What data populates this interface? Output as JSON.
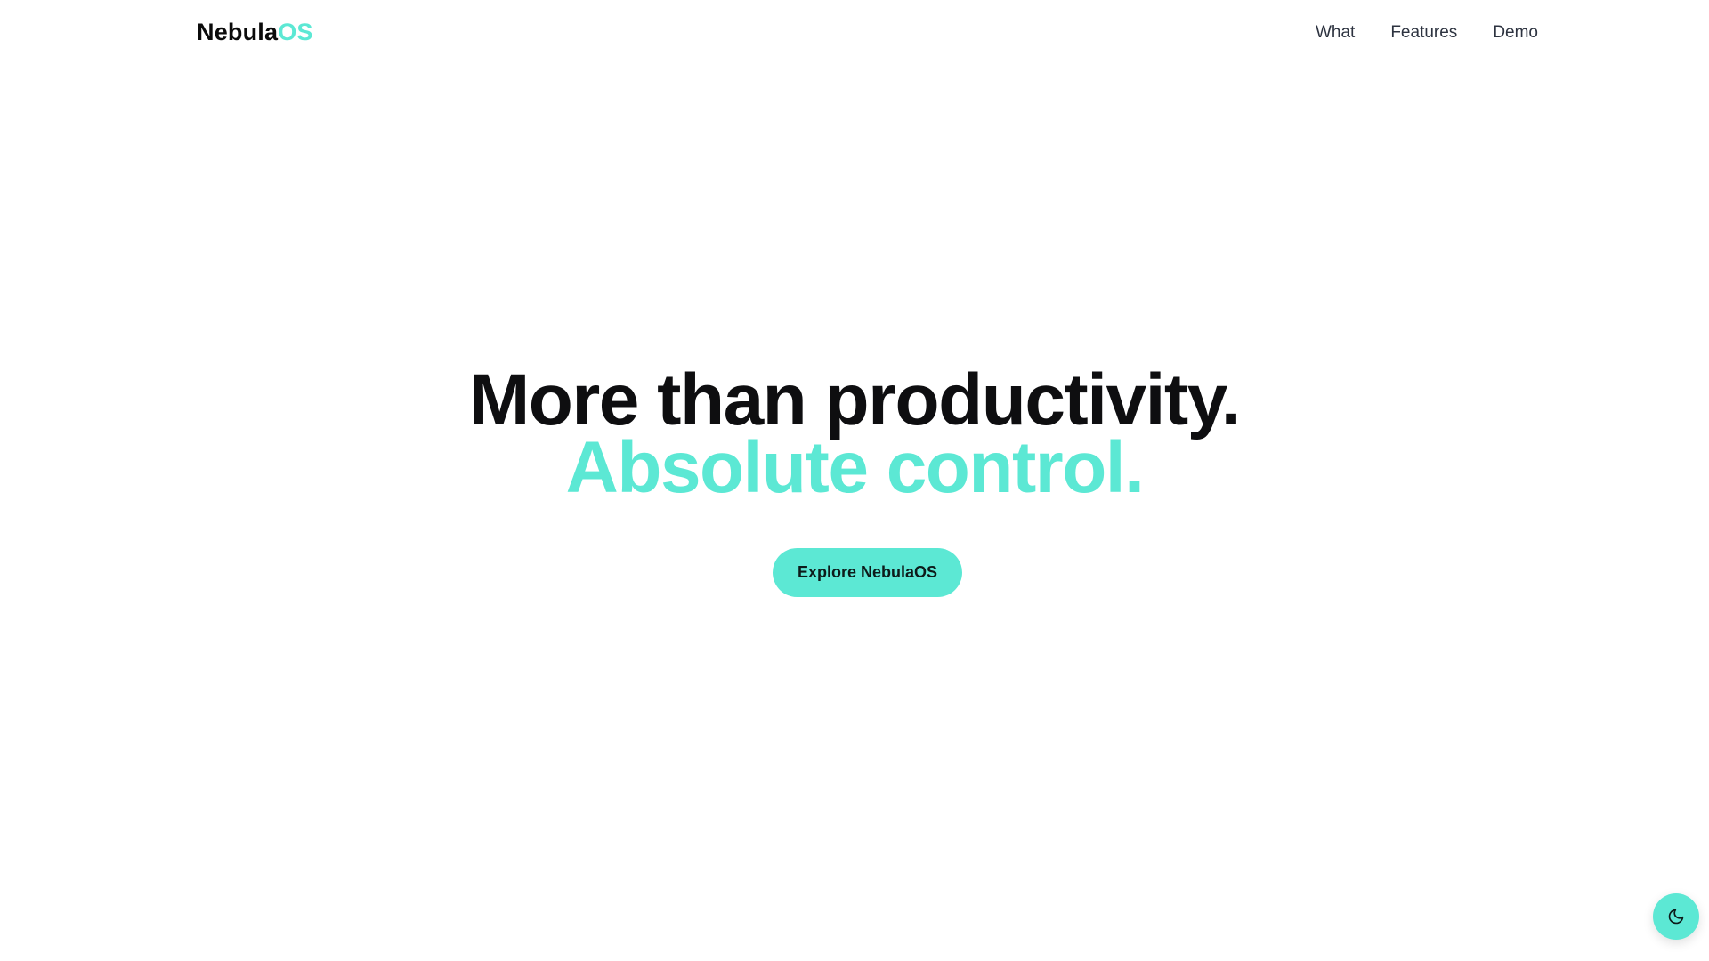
{
  "brand": {
    "name_part1": "Nebula",
    "name_part2": "OS",
    "accent_color": "#5ce8d4"
  },
  "nav": {
    "items": [
      {
        "label": "What"
      },
      {
        "label": "Features"
      },
      {
        "label": "Demo"
      }
    ]
  },
  "hero": {
    "line1": "More than productivity.",
    "line2": "Absolute control.",
    "cta_label": "Explore NebulaOS"
  },
  "theme_toggle": {
    "icon": "moon-icon"
  }
}
